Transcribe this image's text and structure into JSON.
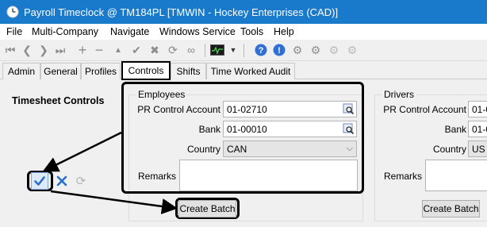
{
  "window": {
    "title": "Payroll Timeclock @ TM184PL [TMWIN - Hockey Enterprises (CAD)]"
  },
  "menu": [
    "File",
    "Multi-Company",
    "Navigate",
    "Windows Service",
    "Tools",
    "Help"
  ],
  "toolbar": {
    "icons": [
      "first-icon",
      "prev-icon",
      "next-icon",
      "last-icon",
      "add-icon",
      "remove-icon",
      "up-icon",
      "check-icon",
      "cancel-icon",
      "refresh-icon",
      "binoculars-icon",
      "monitor-icon",
      "dropdown-icon",
      "help-icon",
      "info-icon",
      "gear-icon",
      "gear-alt-icon",
      "gear-faded-icon",
      "gear-faded-alt-icon"
    ]
  },
  "tabs": [
    "Admin",
    "General",
    "Profiles",
    "Controls",
    "Shifts",
    "Time Worked Audit"
  ],
  "active_tab": "Controls",
  "heading": "Timesheet Controls",
  "employees": {
    "legend": "Employees",
    "pr_label": "PR Control Account",
    "pr_value": "01-02710",
    "bank_label": "Bank",
    "bank_value": "01-00010",
    "country_label": "Country",
    "country_value": "CAN",
    "remarks_label": "Remarks",
    "create_batch": "Create Batch"
  },
  "drivers": {
    "legend": "Drivers",
    "pr_label": "PR Control Account",
    "pr_value": "01-0",
    "bank_label": "Bank",
    "bank_value": "01-0",
    "country_label": "Country",
    "country_value": "US",
    "remarks_label": "Remarks",
    "create_batch": "Create Batch"
  },
  "colors": {
    "titlebar": "#1979ca",
    "accent_check": "#2a6fc9",
    "cancel_x": "#2a6fc9"
  }
}
